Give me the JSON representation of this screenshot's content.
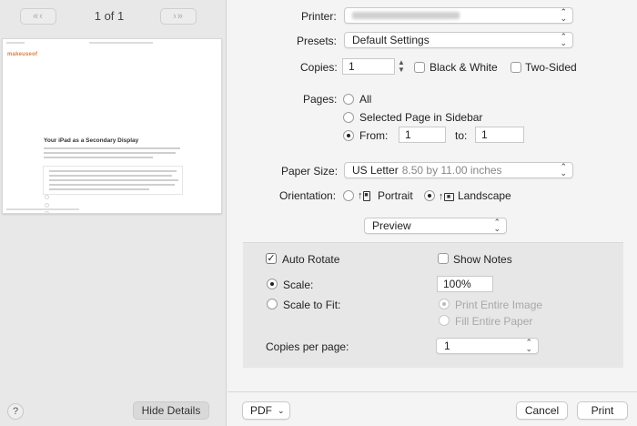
{
  "preview": {
    "prev_button": "«‹",
    "next_button": "›»",
    "page_counter": "1 of 1",
    "thumbnail": {
      "logo": "makeuseof",
      "heading": "Your iPad as a Secondary Display"
    }
  },
  "left_footer": {
    "help": "?",
    "hide_details": "Hide Details"
  },
  "printer": {
    "label": "Printer:",
    "value": ""
  },
  "presets": {
    "label": "Presets:",
    "value": "Default Settings"
  },
  "copies": {
    "label": "Copies:",
    "value": "1",
    "black_white_label": "Black & White",
    "black_white_checked": false,
    "two_sided_label": "Two-Sided",
    "two_sided_checked": false
  },
  "pages": {
    "label": "Pages:",
    "all_label": "All",
    "selected_label": "Selected Page in Sidebar",
    "from_label": "From:",
    "from_value": "1",
    "to_label": "to:",
    "to_value": "1",
    "selected_option": "from"
  },
  "paper_size": {
    "label": "Paper Size:",
    "value": "US Letter",
    "detail": "8.50 by 11.00 inches"
  },
  "orientation": {
    "label": "Orientation:",
    "portrait_label": "Portrait",
    "landscape_label": "Landscape",
    "selected": "landscape"
  },
  "section_select": {
    "value": "Preview"
  },
  "preview_options": {
    "auto_rotate_label": "Auto Rotate",
    "auto_rotate_checked": true,
    "show_notes_label": "Show Notes",
    "show_notes_checked": false,
    "scale_label": "Scale:",
    "scale_value": "100%",
    "scale_to_fit_label": "Scale to Fit:",
    "print_entire_image_label": "Print Entire Image",
    "fill_entire_paper_label": "Fill Entire Paper",
    "copies_per_page_label": "Copies per page:",
    "copies_per_page_value": "1"
  },
  "footer": {
    "pdf_label": "PDF",
    "cancel_label": "Cancel",
    "print_label": "Print"
  }
}
